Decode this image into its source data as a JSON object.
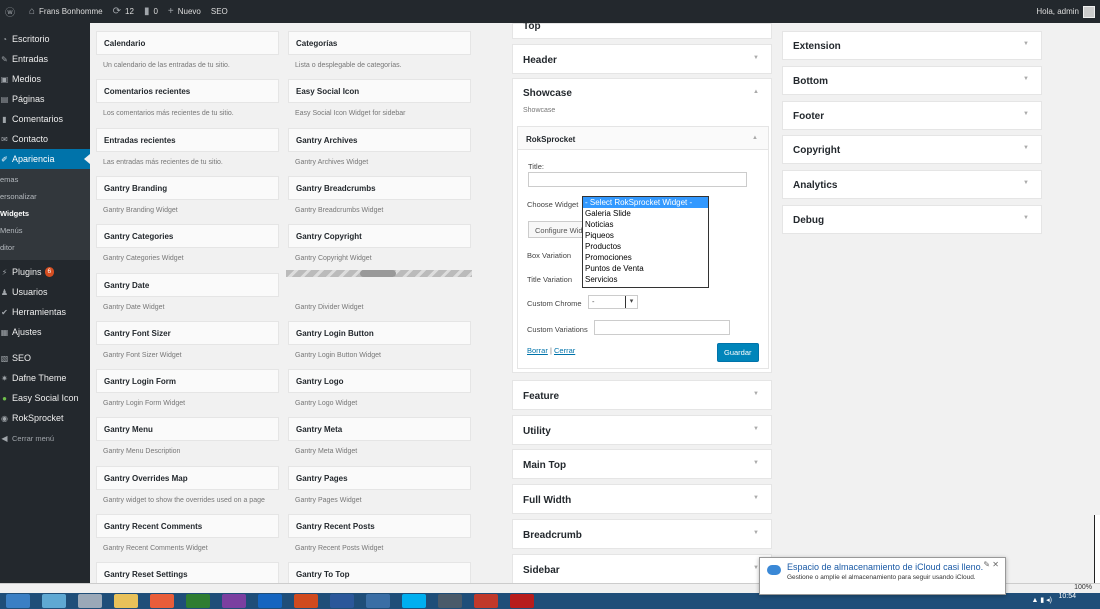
{
  "admin_bar": {
    "site_name": "Frans Bonhomme",
    "updates_count": "12",
    "comments_count": "0",
    "new_label": "Nuevo",
    "seo_label": "SEO",
    "greeting": "Hola, admin"
  },
  "sidebar": {
    "items": [
      {
        "label": "Escritorio"
      },
      {
        "label": "Entradas"
      },
      {
        "label": "Medios"
      },
      {
        "label": "Páginas"
      },
      {
        "label": "Comentarios"
      },
      {
        "label": "Contacto"
      },
      {
        "label": "Apariencia"
      }
    ],
    "submenu": [
      "emas",
      "ersonalizar",
      "Widgets",
      "Menús",
      "ditor"
    ],
    "items2": [
      {
        "label": "Plugins",
        "badge": "6"
      },
      {
        "label": "Usuarios"
      },
      {
        "label": "Herramientas"
      },
      {
        "label": "Ajustes"
      },
      {
        "label": "SEO"
      },
      {
        "label": "Dafne Theme"
      },
      {
        "label": "Easy Social Icon"
      },
      {
        "label": "RokSprocket"
      },
      {
        "label": "Cerrar menú"
      }
    ]
  },
  "available_widgets": [
    {
      "title": "Calendario",
      "desc": "Un calendario de las entradas de tu sitio."
    },
    {
      "title": "Categorías",
      "desc": "Lista o desplegable de categorías."
    },
    {
      "title": "Comentarios recientes",
      "desc": "Los comentarios más recientes de tu sitio."
    },
    {
      "title": "Easy Social Icon",
      "desc": "Easy Social Icon Widget for sidebar"
    },
    {
      "title": "Entradas recientes",
      "desc": "Las entradas más recientes de tu sitio."
    },
    {
      "title": "Gantry Archives",
      "desc": "Gantry Archives Widget"
    },
    {
      "title": "Gantry Branding",
      "desc": "Gantry Branding Widget"
    },
    {
      "title": "Gantry Breadcrumbs",
      "desc": "Gantry Breadcrumbs Widget"
    },
    {
      "title": "Gantry Categories",
      "desc": "Gantry Categories Widget"
    },
    {
      "title": "Gantry Copyright",
      "desc": "Gantry Copyright Widget"
    },
    {
      "title": "Gantry Date",
      "desc": "Gantry Date Widget"
    },
    {
      "title": "",
      "desc": "Gantry Divider Widget"
    },
    {
      "title": "Gantry Font Sizer",
      "desc": "Gantry Font Sizer Widget"
    },
    {
      "title": "Gantry Login Button",
      "desc": "Gantry Login Button Widget"
    },
    {
      "title": "Gantry Login Form",
      "desc": "Gantry Login Form Widget"
    },
    {
      "title": "Gantry Logo",
      "desc": "Gantry Logo Widget"
    },
    {
      "title": "Gantry Menu",
      "desc": "Gantry Menu Description"
    },
    {
      "title": "Gantry Meta",
      "desc": "Gantry Meta Widget"
    },
    {
      "title": "Gantry Overrides Map",
      "desc": "Gantry widget to show the overrides used on a page"
    },
    {
      "title": "Gantry Pages",
      "desc": "Gantry Pages Widget"
    },
    {
      "title": "Gantry Recent Comments",
      "desc": "Gantry Recent Comments Widget"
    },
    {
      "title": "Gantry Recent Posts",
      "desc": "Gantry Recent Posts Widget"
    },
    {
      "title": "Gantry Reset Settings",
      "desc": ""
    },
    {
      "title": "Gantry To Top",
      "desc": ""
    }
  ],
  "areas_mid": {
    "top": "Top",
    "header": "Header",
    "showcase": "Showcase",
    "showcase_desc": "Showcase",
    "feature": "Feature",
    "utility": "Utility",
    "main_top": "Main Top",
    "full_width": "Full Width",
    "breadcrumb": "Breadcrumb",
    "sidebar": "Sidebar"
  },
  "areas_right": [
    "Extension",
    "Bottom",
    "Footer",
    "Copyright",
    "Analytics",
    "Debug"
  ],
  "roksprocket": {
    "title": "RokSprocket",
    "title_label": "Title:",
    "choose_widget_label": "Choose Widget",
    "configure_button": "Configure Widget",
    "box_variation_label": "Box Variation",
    "title_variation_label": "Title Variation",
    "custom_chrome_label": "Custom Chrome",
    "custom_chrome_value": "-",
    "custom_variations_label": "Custom Variations",
    "delete_link": "Borrar",
    "separator": "|",
    "close_link": "Cerrar",
    "save_button": "Guardar"
  },
  "dropdown": {
    "options": [
      "- Select RokSprocket Widget -",
      "Galeria Slide",
      "Noticias",
      "Piqueos",
      "Productos",
      "Promociones",
      "Puntos de Venta",
      "Servicios"
    ],
    "selected_index": 0
  },
  "notification": {
    "title": "Espacio de almacenamiento de iCloud casi lleno.",
    "body": "Gestione o amplíe el almacenamiento para seguir usando iCloud."
  },
  "zoom": "100%",
  "clock": "10:54",
  "colors": {
    "admin_dark": "#23282d",
    "accent": "#0073aa",
    "badge": "#d54e21",
    "primary_button": "#0085ba"
  }
}
